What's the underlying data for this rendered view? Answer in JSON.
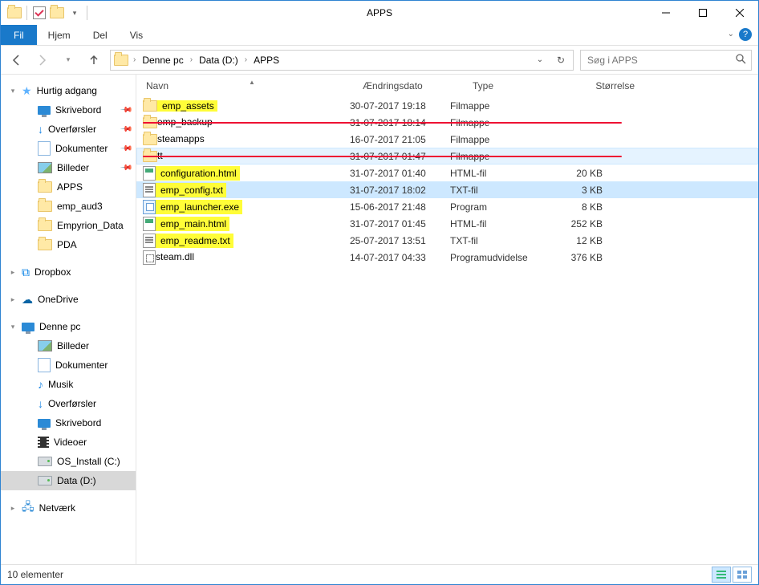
{
  "window": {
    "title": "APPS"
  },
  "ribbon": {
    "file": "Fil",
    "tabs": [
      "Hjem",
      "Del",
      "Vis"
    ]
  },
  "breadcrumb": [
    "Denne pc",
    "Data (D:)",
    "APPS"
  ],
  "search": {
    "placeholder": "Søg i APPS"
  },
  "columns": {
    "name": "Navn",
    "date": "Ændringsdato",
    "type": "Type",
    "size": "Størrelse"
  },
  "rows": [
    {
      "icon": "folder",
      "name": "emp_assets",
      "date": "30-07-2017 19:18",
      "type": "Filmappe",
      "size": "",
      "highlight": true,
      "red": false
    },
    {
      "icon": "folder",
      "name": "emp_backup",
      "date": "31-07-2017 18:14",
      "type": "Filmappe",
      "size": "",
      "highlight": false,
      "red": true
    },
    {
      "icon": "folder",
      "name": "steamapps",
      "date": "16-07-2017 21:05",
      "type": "Filmappe",
      "size": "",
      "highlight": false,
      "red": false
    },
    {
      "icon": "folder",
      "name": "tt",
      "date": "31-07-2017 01:47",
      "type": "Filmappe",
      "size": "",
      "highlight": false,
      "red": true,
      "hover": true
    },
    {
      "icon": "htmlf",
      "name": "configuration.html",
      "date": "31-07-2017 01:40",
      "type": "HTML-fil",
      "size": "20 KB",
      "highlight": true,
      "red": false
    },
    {
      "icon": "txtf",
      "name": "emp_config.txt",
      "date": "31-07-2017 18:02",
      "type": "TXT-fil",
      "size": "3 KB",
      "highlight": true,
      "red": false,
      "selected": true
    },
    {
      "icon": "exef",
      "name": "emp_launcher.exe",
      "date": "15-06-2017 21:48",
      "type": "Program",
      "size": "8 KB",
      "highlight": true,
      "red": false
    },
    {
      "icon": "htmlf",
      "name": "emp_main.html",
      "date": "31-07-2017 01:45",
      "type": "HTML-fil",
      "size": "252 KB",
      "highlight": true,
      "red": false
    },
    {
      "icon": "txtf",
      "name": "emp_readme.txt",
      "date": "25-07-2017 13:51",
      "type": "TXT-fil",
      "size": "12 KB",
      "highlight": true,
      "red": false
    },
    {
      "icon": "dllf",
      "name": "steam.dll",
      "date": "14-07-2017 04:33",
      "type": "Programudvidelse",
      "size": "376 KB",
      "highlight": false,
      "red": false
    }
  ],
  "nav": {
    "quick": {
      "label": "Hurtig adgang",
      "items": [
        {
          "label": "Skrivebord",
          "icon": "monitor",
          "pin": true
        },
        {
          "label": "Overførsler",
          "icon": "dl",
          "pin": true
        },
        {
          "label": "Dokumenter",
          "icon": "doc",
          "pin": true
        },
        {
          "label": "Billeder",
          "icon": "pic",
          "pin": true
        },
        {
          "label": "APPS",
          "icon": "folder",
          "pin": false
        },
        {
          "label": "emp_aud3",
          "icon": "folder",
          "pin": false
        },
        {
          "label": "Empyrion_Data",
          "icon": "folder",
          "pin": false
        },
        {
          "label": "PDA",
          "icon": "folder",
          "pin": false
        }
      ]
    },
    "dropbox": {
      "label": "Dropbox"
    },
    "onedrive": {
      "label": "OneDrive"
    },
    "thispc": {
      "label": "Denne pc",
      "items": [
        {
          "label": "Billeder",
          "icon": "pic"
        },
        {
          "label": "Dokumenter",
          "icon": "doc"
        },
        {
          "label": "Musik",
          "icon": "music"
        },
        {
          "label": "Overførsler",
          "icon": "dl"
        },
        {
          "label": "Skrivebord",
          "icon": "monitor"
        },
        {
          "label": "Videoer",
          "icon": "film"
        },
        {
          "label": "OS_Install (C:)",
          "icon": "drive"
        },
        {
          "label": "Data (D:)",
          "icon": "drive",
          "selected": true
        }
      ]
    },
    "network": {
      "label": "Netværk"
    }
  },
  "status": {
    "text": "10 elementer"
  }
}
